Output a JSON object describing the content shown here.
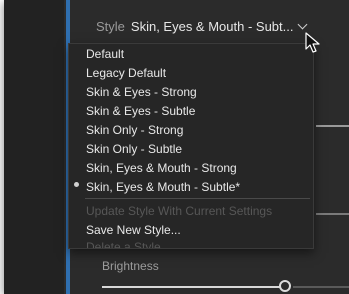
{
  "style_header": {
    "label": "Style",
    "value": "Skin, Eyes & Mouth - Subt..."
  },
  "menu": {
    "items": [
      {
        "label": "Default",
        "enabled": true
      },
      {
        "label": "Legacy Default",
        "enabled": true
      },
      {
        "label": "Skin & Eyes - Strong",
        "enabled": true
      },
      {
        "label": "Skin & Eyes - Subtle",
        "enabled": true
      },
      {
        "label": "Skin Only - Strong",
        "enabled": true
      },
      {
        "label": "Skin Only - Subtle",
        "enabled": true
      },
      {
        "label": "Skin, Eyes & Mouth - Strong",
        "enabled": true
      },
      {
        "label": "Skin, Eyes & Mouth - Subtle*",
        "enabled": true,
        "selected": true
      },
      {
        "label": "Update Style With Current Settings",
        "enabled": false
      },
      {
        "label": "Save New Style...",
        "enabled": true
      },
      {
        "label": "Delete a Style...",
        "enabled": false
      }
    ]
  },
  "brightness": {
    "label": "Brightness",
    "slider_fraction": 0.76
  },
  "colors": {
    "panel_bg": "#2b2b2b",
    "accent": "#2f6fb0",
    "menu_bg": "#262626",
    "text": "#e8e8e8",
    "text_disabled": "#575757"
  },
  "icons": {
    "cursor": "pointer-cursor-icon",
    "dropdown": "chevron-down-icon",
    "selected_marker": "bullet-icon"
  }
}
